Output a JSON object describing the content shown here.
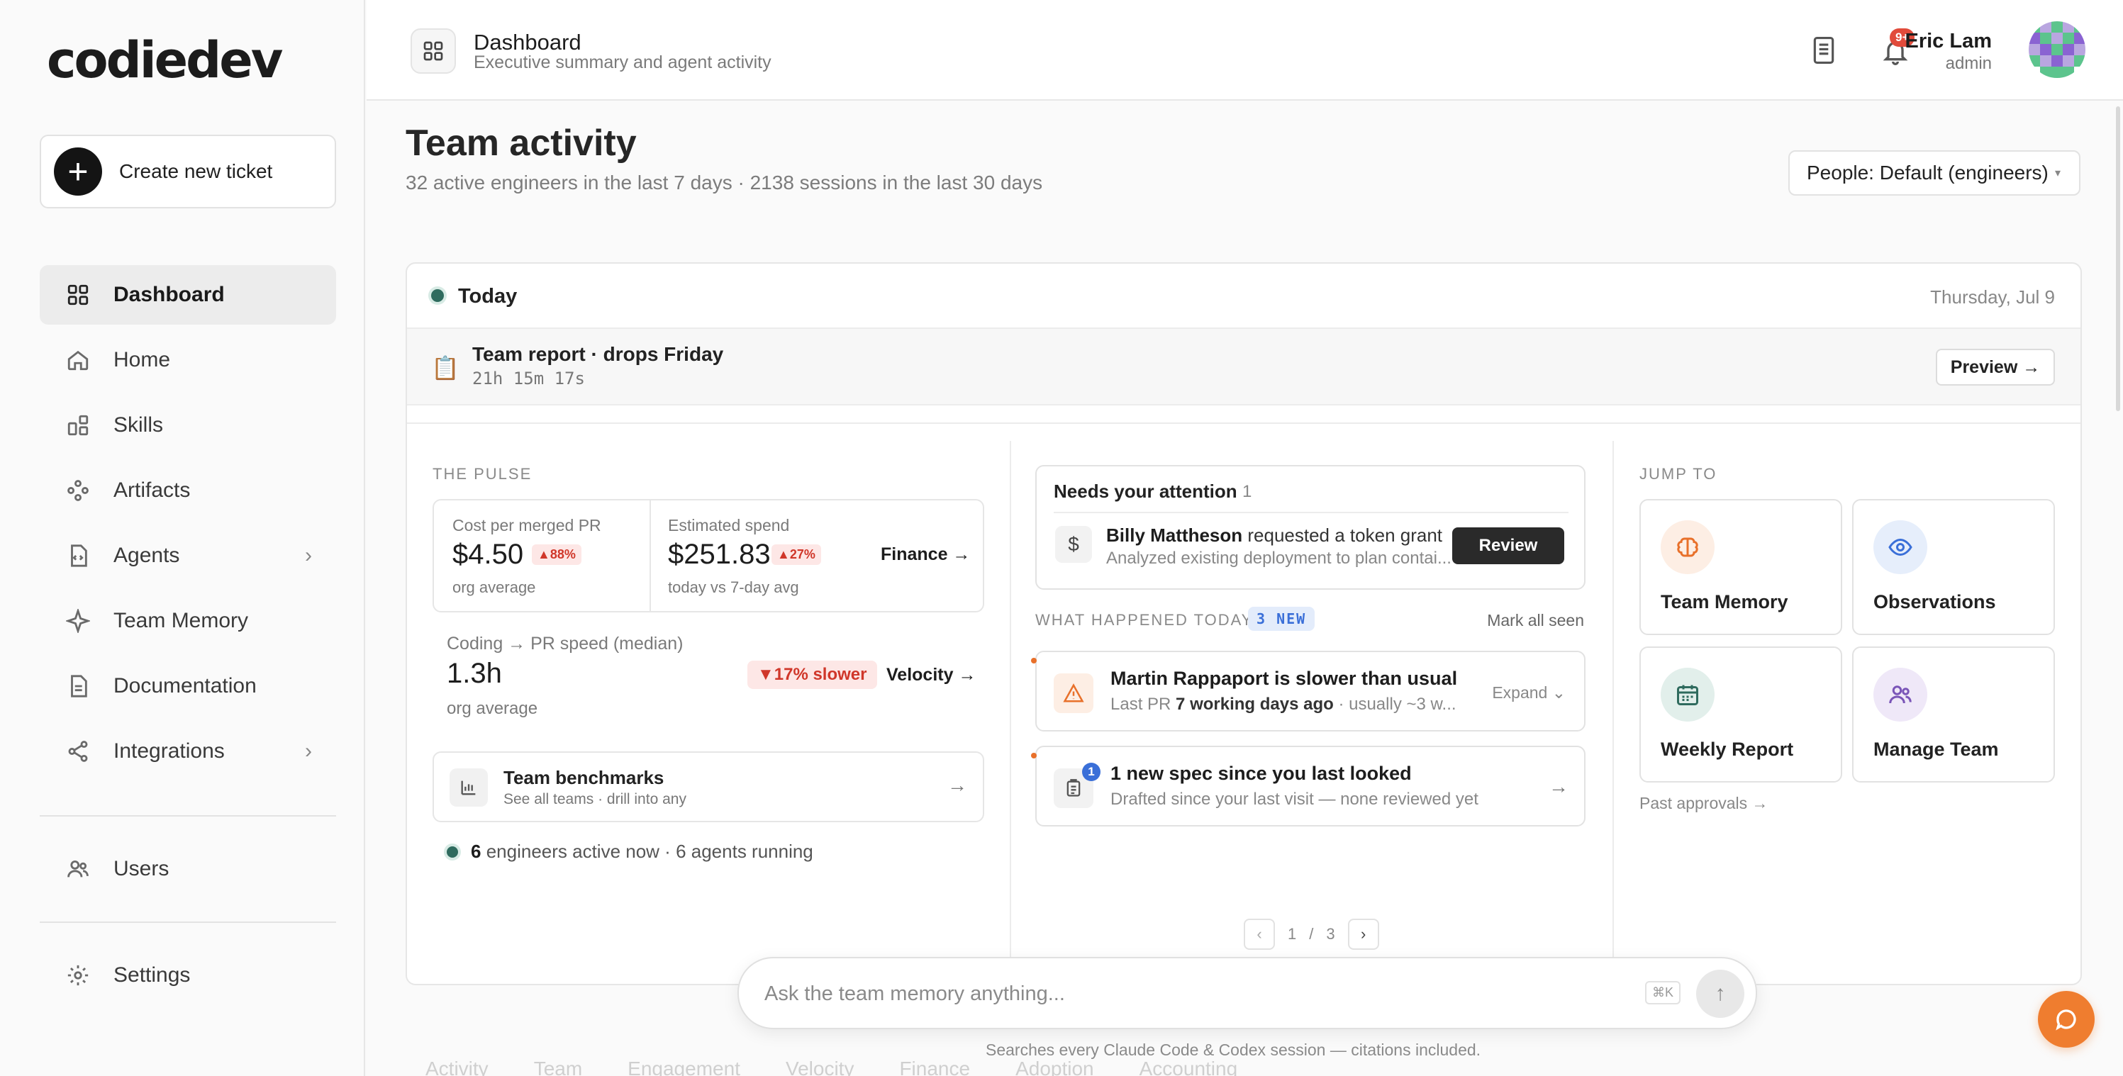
{
  "brand": {
    "logo": "codiedev",
    "accent": "#ef7d2f"
  },
  "sidebar": {
    "create_label": "Create new ticket",
    "items": [
      {
        "label": "Dashboard",
        "icon": "grid-icon",
        "active": true
      },
      {
        "label": "Home",
        "icon": "home-icon"
      },
      {
        "label": "Skills",
        "icon": "skills-icon"
      },
      {
        "label": "Artifacts",
        "icon": "artifacts-icon"
      },
      {
        "label": "Agents",
        "icon": "agents-icon",
        "expandable": true
      },
      {
        "label": "Team Memory",
        "icon": "sparkle-icon"
      },
      {
        "label": "Documentation",
        "icon": "document-icon"
      },
      {
        "label": "Integrations",
        "icon": "share-icon",
        "expandable": true
      },
      {
        "label": "Users",
        "icon": "users-icon"
      },
      {
        "label": "Settings",
        "icon": "gear-icon"
      }
    ]
  },
  "header": {
    "title": "Dashboard",
    "subtitle": "Executive summary and agent activity",
    "notification_badge": "9+",
    "user_name": "Eric Lam",
    "user_role": "admin"
  },
  "main": {
    "title": "Team activity",
    "subtitle": "32 active engineers in the last 7 days · 2138 sessions in the last 30 days",
    "people_filter": "People: Default (engineers)",
    "today": {
      "label": "Today",
      "date": "Thursday, Jul 9",
      "report_title": "Team report · drops Friday",
      "report_timer": "21h 15m 17s",
      "preview_label": "Preview →"
    },
    "pulse": {
      "section_label": "THE PULSE",
      "cost_label": "Cost per merged PR",
      "cost_value": "$4.50",
      "cost_change": "▲88%",
      "cost_note": "org average",
      "spend_label": "Estimated spend",
      "spend_value": "$251.83",
      "spend_change": "▲27%",
      "spend_note": "today vs 7-day avg",
      "finance_link": "Finance →",
      "speed_label": "Coding → PR speed (median)",
      "speed_value": "1.3h",
      "speed_note": "org average",
      "speed_change": "▼17% slower",
      "velocity_link": "Velocity →",
      "bench_title": "Team benchmarks",
      "bench_sub": "See all teams · drill into any",
      "active_count": "6",
      "active_text": "engineers active now · 6 agents running"
    },
    "attention": {
      "title": "Needs your attention",
      "count": "1",
      "requester": "Billy Mattheson",
      "action": "requested a token grant",
      "detail": "Analyzed existing deployment to plan contai...",
      "review_label": "Review"
    },
    "happened": {
      "label": "WHAT HAPPENED TODAY",
      "new_chip": "3 NEW",
      "mark_seen": "Mark all seen",
      "events": [
        {
          "title": "Martin Rappaport is slower than usual",
          "sub_prefix": "Last PR",
          "sub_bold": "7 working days ago",
          "sub_suffix": "· usually ~3 w...",
          "action": "Expand"
        },
        {
          "title": "1 new spec since you last looked",
          "sub": "Drafted since your last visit — none reviewed yet",
          "badge": "1"
        }
      ],
      "page_current": "1",
      "page_sep": "/",
      "page_total": "3"
    },
    "jump": {
      "section_label": "JUMP TO",
      "cards": [
        {
          "label": "Team Memory",
          "icon": "brain-icon",
          "color": "#e8702a",
          "bg": "#fdeee4"
        },
        {
          "label": "Observations",
          "icon": "eye-icon",
          "color": "#3a6fd8",
          "bg": "#e6eefb"
        },
        {
          "label": "Weekly Report",
          "icon": "calendar-icon",
          "color": "#2f6b5e",
          "bg": "#e2efeb"
        },
        {
          "label": "Manage Team",
          "icon": "people-icon",
          "color": "#7a55b8",
          "bg": "#efe8f8"
        }
      ],
      "past_link": "Past approvals →"
    }
  },
  "chat": {
    "placeholder": "Ask the team memory anything...",
    "shortcut": "⌘K",
    "note": "Searches every Claude Code & Codex session — citations included."
  },
  "tabs": [
    "Activity",
    "Team",
    "Engagement",
    "Velocity",
    "Finance",
    "Adoption",
    "Accounting"
  ]
}
